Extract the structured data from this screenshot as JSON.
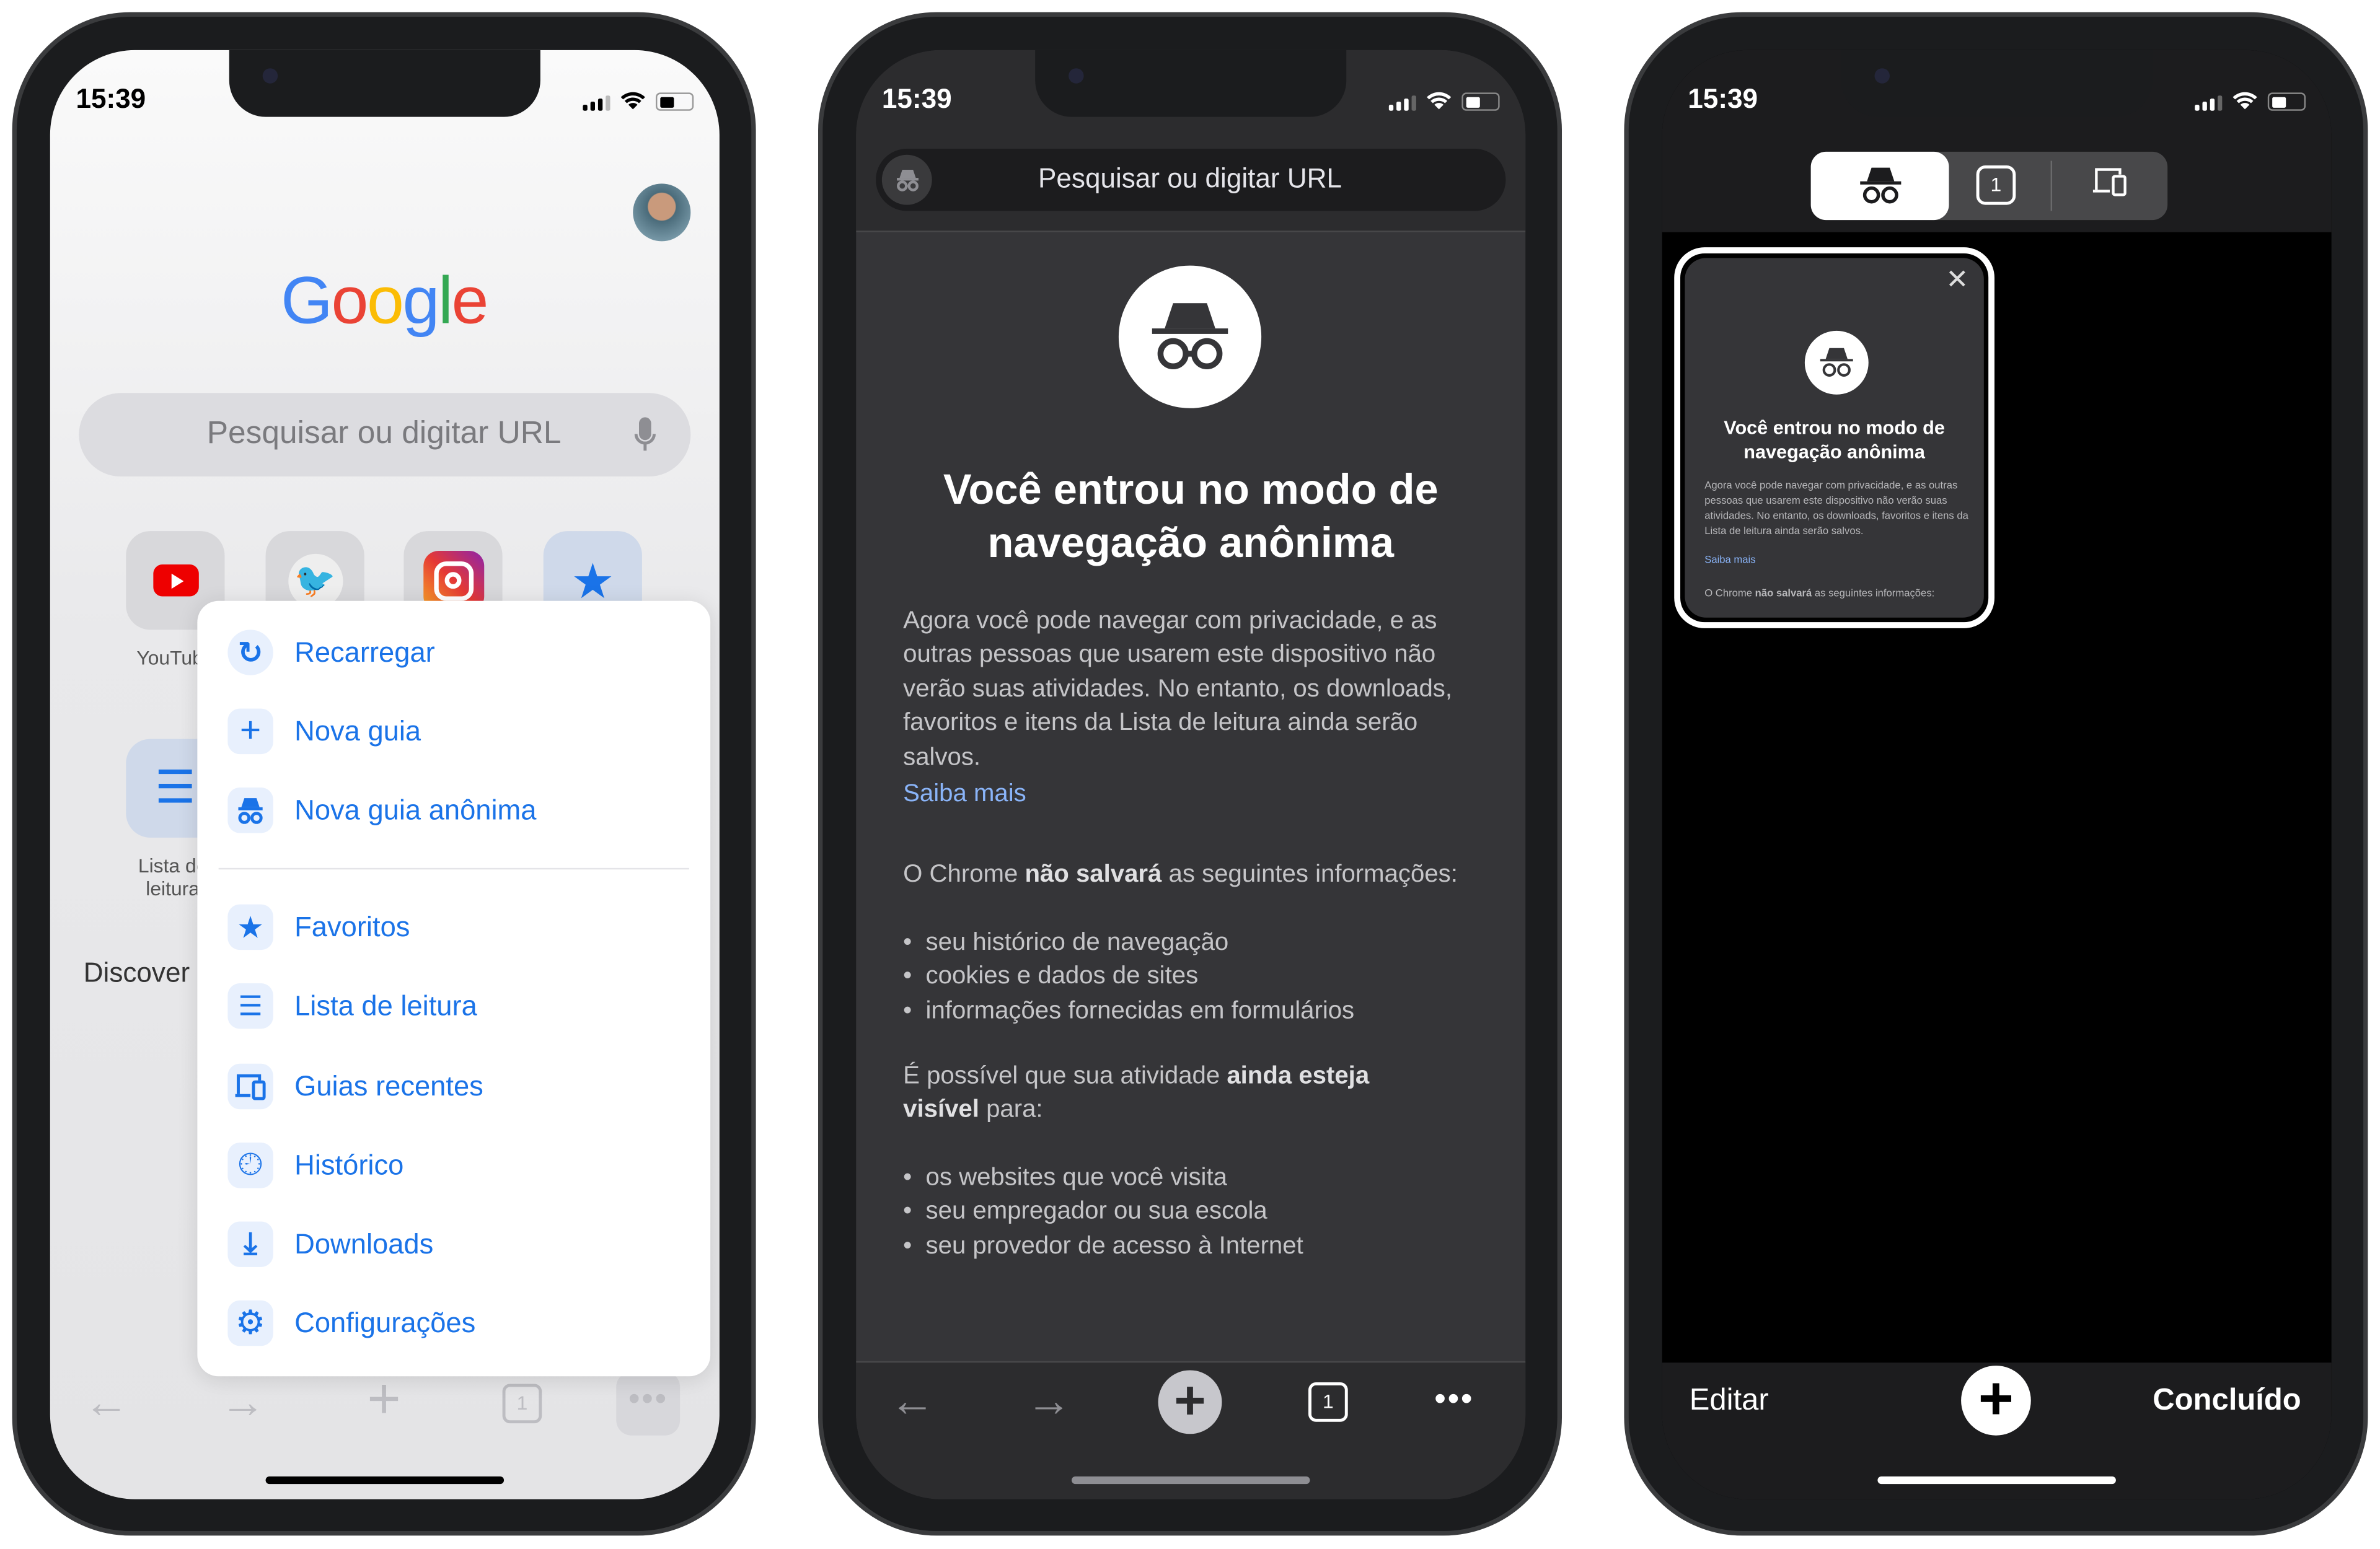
{
  "status_bar": {
    "time": "15:39"
  },
  "phone1": {
    "logo_text": "Google",
    "logo_colors": [
      "#4285f4",
      "#ea4335",
      "#fbbc05",
      "#4285f4",
      "#34a853",
      "#ea4335"
    ],
    "search_placeholder": "Pesquisar ou digitar URL",
    "shortcuts": [
      {
        "label": "YouTube",
        "icon": "youtube-icon"
      },
      {
        "label": "",
        "icon": "twitter-icon"
      },
      {
        "label": "",
        "icon": "instagram-icon"
      },
      {
        "label": "",
        "icon": "star-icon"
      }
    ],
    "reading_list_label_1": "Lista de",
    "reading_list_label_2": "leitura",
    "discover": "Discover",
    "menu": {
      "accent": "#1a73e8",
      "group1": [
        {
          "label": "Recarregar",
          "icon": "reload-icon"
        },
        {
          "label": "Nova guia",
          "icon": "plus-icon"
        },
        {
          "label": "Nova guia anônima",
          "icon": "incognito-icon"
        }
      ],
      "group2": [
        {
          "label": "Favoritos",
          "icon": "star-icon"
        },
        {
          "label": "Lista de leitura",
          "icon": "list-icon"
        },
        {
          "label": "Guias recentes",
          "icon": "devices-icon"
        },
        {
          "label": "Histórico",
          "icon": "history-icon"
        },
        {
          "label": "Downloads",
          "icon": "download-icon"
        },
        {
          "label": "Configurações",
          "icon": "gear-icon"
        }
      ]
    },
    "tab_count": "1"
  },
  "phone2": {
    "search_placeholder": "Pesquisar ou digitar URL",
    "title_line1": "Você entrou no modo de",
    "title_line2": "navegação anônima",
    "intro": "Agora você pode navegar com privacidade, e as outras pessoas que usarem este dispositivo não verão suas atividades. No entanto, os downloads, favoritos e itens da Lista de leitura ainda serão salvos.",
    "learn_more": "Saiba mais",
    "not_saved_pre": "O Chrome ",
    "not_saved_bold": "não salvará",
    "not_saved_post": " as seguintes informações:",
    "not_saved_items": [
      "seu histórico de navegação",
      "cookies e dados de sites",
      "informações fornecidas em formulários"
    ],
    "visible_pre": "É possível que sua atividade ",
    "visible_bold": "ainda esteja visível",
    "visible_post": " para:",
    "visible_items": [
      "os websites que você visita",
      "seu empregador ou sua escola",
      "seu provedor de acesso à Internet"
    ],
    "link_color": "#8ab4f8",
    "tab_count": "1"
  },
  "phone3": {
    "segments": [
      {
        "icon": "incognito-icon",
        "selected": true
      },
      {
        "icon": "tab-count-icon",
        "label": "1",
        "selected": false
      },
      {
        "icon": "devices-icon",
        "selected": false
      }
    ],
    "card": {
      "title_line1": "Você entrou no modo de",
      "title_line2": "navegação anônima",
      "intro": "Agora você pode navegar com privacidade, e as outras pessoas que usarem este dispositivo não verão suas atividades. No entanto, os downloads, favoritos e itens da Lista de leitura ainda serão salvos.",
      "learn_more": "Saiba mais",
      "not_saved_pre": "O Chrome ",
      "not_saved_bold": "não salvará",
      "not_saved_post": " as seguintes informações:"
    },
    "edit": "Editar",
    "done": "Concluído"
  }
}
